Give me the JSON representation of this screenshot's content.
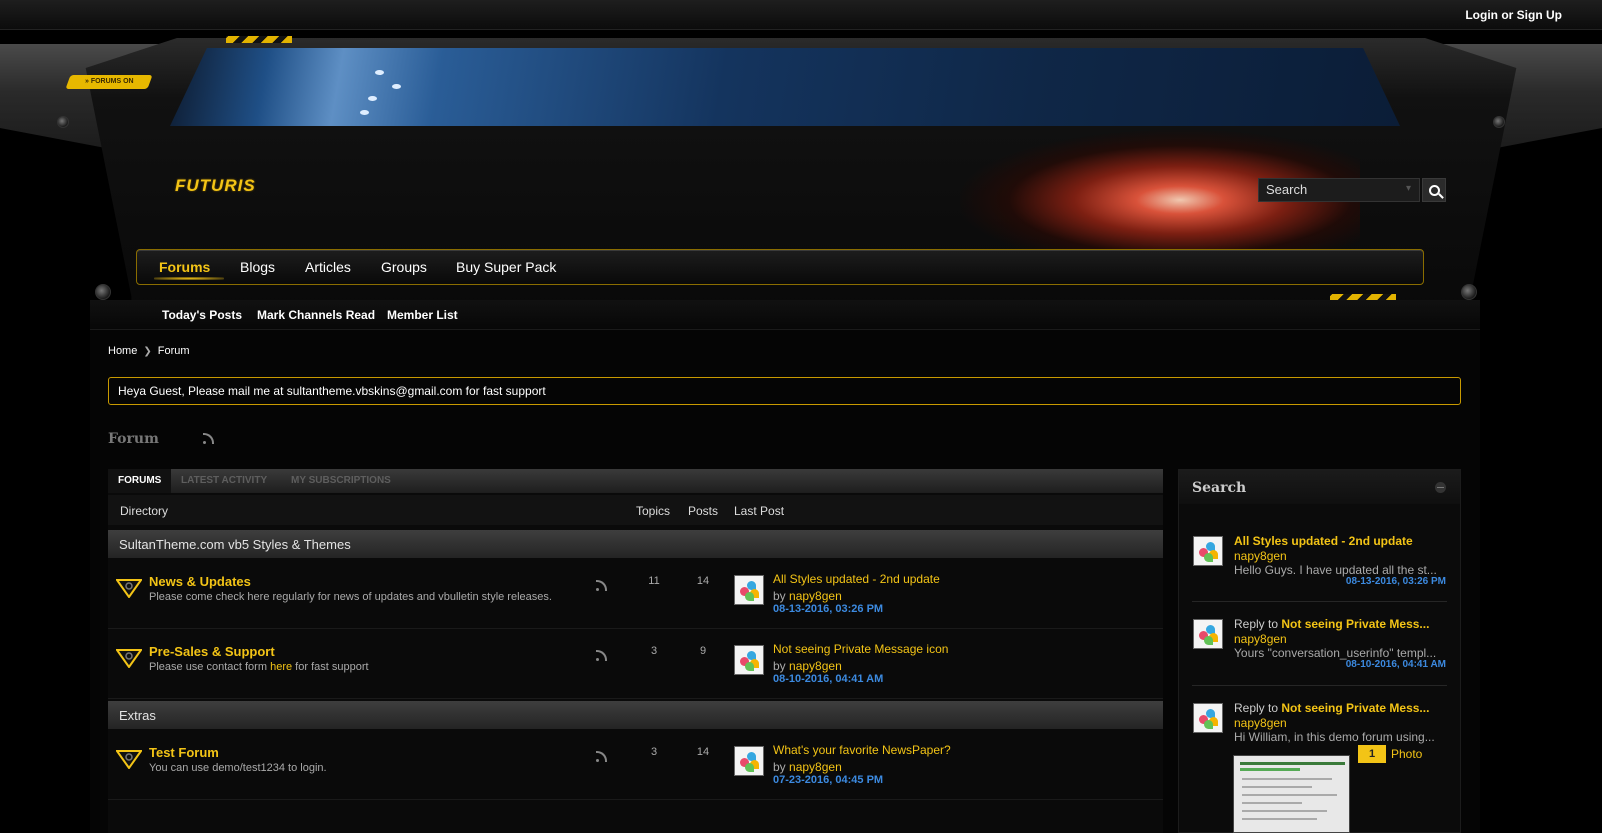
{
  "top": {
    "login": "Login",
    "or": "or",
    "signup": "Sign Up"
  },
  "header": {
    "badge": "» FORUMS ON",
    "logo": "FUTURIS",
    "search_placeholder": "Search"
  },
  "nav": {
    "tabs": [
      {
        "label": "Forums"
      },
      {
        "label": "Blogs"
      },
      {
        "label": "Articles"
      },
      {
        "label": "Groups"
      },
      {
        "label": "Buy Super Pack"
      }
    ],
    "sub": [
      "Today's Posts",
      "Mark Channels Read",
      "Member List"
    ]
  },
  "breadcrumb": {
    "home": "Home",
    "current": "Forum"
  },
  "notice": "Heya Guest, Please mail me at sultantheme.vbskins@gmail.com for fast support",
  "page_title": "Forum",
  "forum_tabs": [
    "FORUMS",
    "LATEST ACTIVITY",
    "MY SUBSCRIPTIONS"
  ],
  "columns": {
    "directory": "Directory",
    "topics": "Topics",
    "posts": "Posts",
    "last_post": "Last Post"
  },
  "categories": [
    {
      "title": "SultanTheme.com vb5 Styles & Themes",
      "forums": [
        {
          "title": "News & Updates",
          "desc": "Please come check here regularly for news of updates and vbulletin style releases.",
          "topics": "11",
          "posts": "14",
          "lp_title": "All Styles updated - 2nd update",
          "lp_by": "by",
          "lp_user": "napy8gen",
          "lp_date": "08-13-2016, 03:26 PM"
        },
        {
          "title": "Pre-Sales & Support",
          "desc_pre": "Please use contact form",
          "desc_link": "here",
          "desc_post": "for fast support",
          "topics": "3",
          "posts": "9",
          "lp_title": "Not seeing Private Message icon",
          "lp_by": "by",
          "lp_user": "napy8gen",
          "lp_date": "08-10-2016, 04:41 AM"
        }
      ]
    },
    {
      "title": "Extras",
      "forums": [
        {
          "title": "Test Forum",
          "desc": "You can use demo/test1234 to login.",
          "topics": "3",
          "posts": "14",
          "lp_title": "What's your favorite NewsPaper?",
          "lp_by": "by",
          "lp_user": "napy8gen",
          "lp_date": "07-23-2016, 04:45 PM"
        }
      ]
    }
  ],
  "sidebar": {
    "title": "Search",
    "items": [
      {
        "pre": "",
        "title": "All Styles updated - 2nd update",
        "user": "napy8gen",
        "text": "Hello Guys. I have updated all the st...",
        "date": "08-13-2016, 03:26 PM"
      },
      {
        "pre": "Reply to",
        "title": "Not seeing Private Mess...",
        "user": "napy8gen",
        "text": "Yours \"conversation_userinfo\" templ...",
        "date": "08-10-2016, 04:41 AM"
      },
      {
        "pre": "Reply to",
        "title": "Not seeing Private Mess...",
        "user": "napy8gen",
        "text": "Hi William, in this demo forum using...",
        "date": ""
      }
    ],
    "photo_count": "1",
    "photo_label": "Photo"
  },
  "colors": {
    "accent": "#f3c416",
    "date_blue": "#3c8ae0",
    "background": "#000000"
  }
}
